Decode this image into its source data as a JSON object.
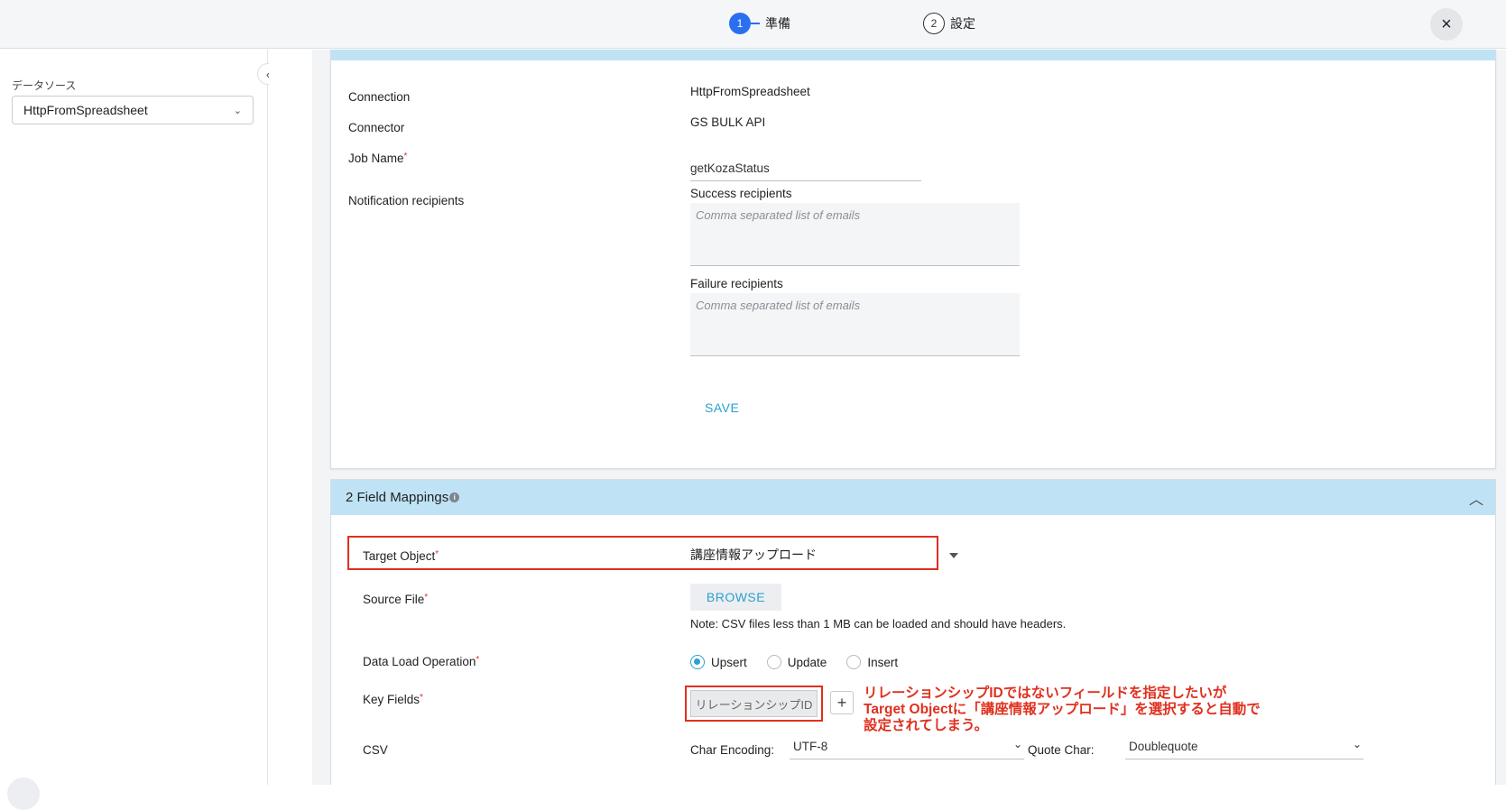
{
  "stepper": {
    "steps": [
      {
        "number": "1",
        "label": "準備"
      },
      {
        "number": "2",
        "label": "設定"
      }
    ],
    "close_icon": "×"
  },
  "sidebar": {
    "datasource_label": "データソース",
    "datasource_value": "HttpFromSpreadsheet",
    "collapse_icon": "‹"
  },
  "job_settings": {
    "connection_label": "Connection",
    "connection_value": "HttpFromSpreadsheet",
    "connector_label": "Connector",
    "connector_value": "GS BULK API",
    "job_name_label": "Job Name",
    "job_name_value": "getKozaStatus",
    "notification_label": "Notification recipients",
    "success_label": "Success recipients",
    "success_placeholder": "Comma separated list of emails",
    "failure_label": "Failure recipients",
    "failure_placeholder": "Comma separated list of emails",
    "save_label": "SAVE"
  },
  "field_mappings": {
    "title": "2 Field Mappings",
    "info_icon": "i",
    "collapse_icon": "︿",
    "target_object_label": "Target Object",
    "target_object_value": "講座情報アップロード",
    "source_file_label": "Source File",
    "browse_label": "BROWSE",
    "note": "Note: CSV files less than 1 MB can be loaded and should have headers.",
    "operation_label": "Data Load Operation",
    "operations": [
      {
        "label": "Upsert",
        "checked": true
      },
      {
        "label": "Update",
        "checked": false
      },
      {
        "label": "Insert",
        "checked": false
      }
    ],
    "key_fields_label": "Key Fields",
    "key_field_value": "リレーションシップID",
    "add_icon": "+",
    "annotation_lines": [
      "リレーションシップIDではないフィールドを指定したいが",
      "Target Objectに「講座情報アップロード」を選択すると自動で",
      "設定されてしまう。"
    ],
    "csv_label": "CSV",
    "char_encoding_label": "Char Encoding:",
    "char_encoding_value": "UTF-8",
    "quote_char_label": "Quote Char:",
    "quote_char_value": "Doublequote"
  },
  "colors": {
    "accent": "#2ba1cf",
    "step_active": "#2a6ff0",
    "header_band": "#bfe3f5",
    "highlight_red": "#e0301e"
  }
}
